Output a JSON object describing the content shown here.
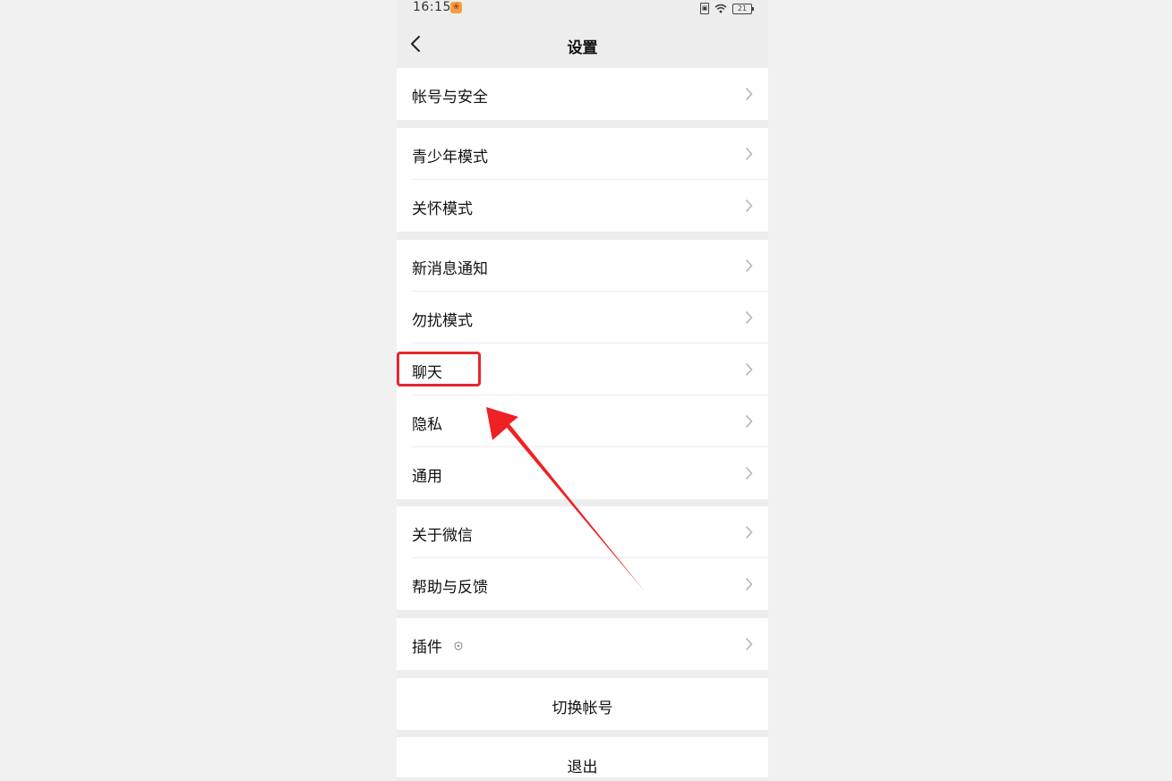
{
  "status_bar": {
    "time": "16:15",
    "sim_glyph": "▣",
    "battery": "21",
    "notification_icon": "app-notification-icon"
  },
  "nav": {
    "title": "设置",
    "back_icon": "chevron-left-icon"
  },
  "groups": [
    {
      "items": [
        {
          "label": "帐号与安全"
        }
      ]
    },
    {
      "items": [
        {
          "label": "青少年模式"
        },
        {
          "label": "关怀模式"
        }
      ]
    },
    {
      "items": [
        {
          "label": "新消息通知"
        },
        {
          "label": "勿扰模式"
        },
        {
          "label": "聊天"
        },
        {
          "label": "隐私"
        },
        {
          "label": "通用"
        }
      ]
    },
    {
      "items": [
        {
          "label": "关于微信"
        },
        {
          "label": "帮助与反馈"
        }
      ]
    },
    {
      "items": [
        {
          "label": "插件",
          "icon": "plugin-icon"
        }
      ]
    }
  ],
  "actions": {
    "switch_account": "切换帐号",
    "logout": "退出"
  },
  "colors": {
    "background": "#ededed",
    "row": "#ffffff",
    "annotation": "#e8262a"
  }
}
